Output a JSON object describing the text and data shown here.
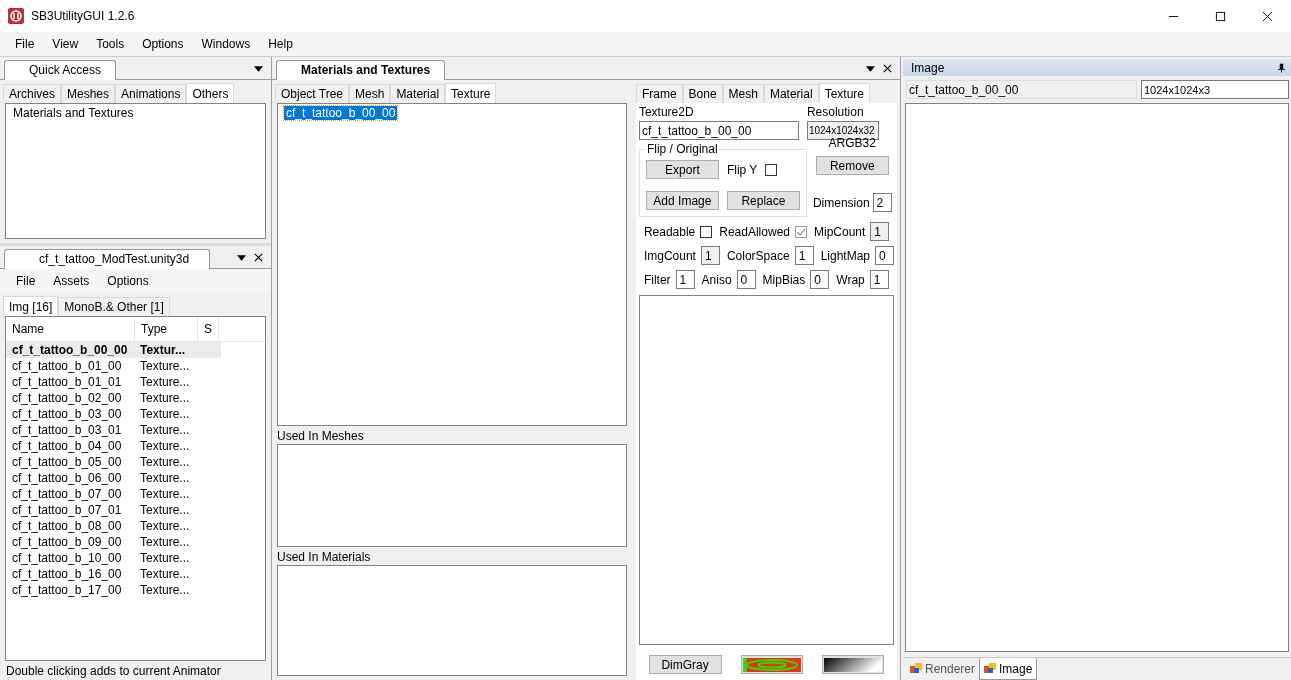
{
  "window": {
    "title": "SB3UtilityGUI 1.2.6"
  },
  "menu": [
    "File",
    "View",
    "Tools",
    "Options",
    "Windows",
    "Help"
  ],
  "quick_access": {
    "title": "Quick Access",
    "tabs": [
      {
        "label": "Archives",
        "selected": false
      },
      {
        "label": "Meshes",
        "selected": false
      },
      {
        "label": "Animations",
        "selected": false
      },
      {
        "label": "Others",
        "selected": true
      }
    ],
    "items": [
      "Materials and Textures"
    ]
  },
  "file_panel": {
    "title": "cf_t_tattoo_ModTest.unity3d",
    "menu": [
      "File",
      "Assets",
      "Options"
    ],
    "tabs": [
      {
        "label": "Img [16]",
        "selected": true
      },
      {
        "label": "MonoB.& Other [1]",
        "selected": false
      }
    ],
    "columns": [
      "Name",
      "Type",
      "S"
    ],
    "rows": [
      {
        "name": "cf_t_tattoo_b_00_00",
        "type": "Textur...",
        "selected": true
      },
      {
        "name": "cf_t_tattoo_b_01_00",
        "type": "Texture...",
        "selected": false
      },
      {
        "name": "cf_t_tattoo_b_01_01",
        "type": "Texture...",
        "selected": false
      },
      {
        "name": "cf_t_tattoo_b_02_00",
        "type": "Texture...",
        "selected": false
      },
      {
        "name": "cf_t_tattoo_b_03_00",
        "type": "Texture...",
        "selected": false
      },
      {
        "name": "cf_t_tattoo_b_03_01",
        "type": "Texture...",
        "selected": false
      },
      {
        "name": "cf_t_tattoo_b_04_00",
        "type": "Texture...",
        "selected": false
      },
      {
        "name": "cf_t_tattoo_b_05_00",
        "type": "Texture...",
        "selected": false
      },
      {
        "name": "cf_t_tattoo_b_06_00",
        "type": "Texture...",
        "selected": false
      },
      {
        "name": "cf_t_tattoo_b_07_00",
        "type": "Texture...",
        "selected": false
      },
      {
        "name": "cf_t_tattoo_b_07_01",
        "type": "Texture...",
        "selected": false
      },
      {
        "name": "cf_t_tattoo_b_08_00",
        "type": "Texture...",
        "selected": false
      },
      {
        "name": "cf_t_tattoo_b_09_00",
        "type": "Texture...",
        "selected": false
      },
      {
        "name": "cf_t_tattoo_b_10_00",
        "type": "Texture...",
        "selected": false
      },
      {
        "name": "cf_t_tattoo_b_16_00",
        "type": "Texture...",
        "selected": false
      },
      {
        "name": "cf_t_tattoo_b_17_00",
        "type": "Texture...",
        "selected": false
      }
    ],
    "status": "Double clicking adds to current Animator"
  },
  "editor": {
    "title": "Materials and Textures",
    "tabs": [
      {
        "label": "Object Tree",
        "selected": false
      },
      {
        "label": "Mesh",
        "selected": false
      },
      {
        "label": "Material",
        "selected": false
      },
      {
        "label": "Texture",
        "selected": true
      }
    ],
    "tree_items": [
      {
        "label": "cf_t_tattoo_b_00_00",
        "selected": true
      }
    ],
    "used_in_meshes": "Used In Meshes",
    "used_in_materials": "Used In Materials"
  },
  "texture": {
    "tabs": [
      {
        "label": "Frame",
        "selected": false
      },
      {
        "label": "Bone",
        "selected": false
      },
      {
        "label": "Mesh",
        "selected": false
      },
      {
        "label": "Material",
        "selected": false
      },
      {
        "label": "Texture",
        "selected": true
      }
    ],
    "name_label": "Texture2D",
    "name": "cf_t_tattoo_b_00_00",
    "resolution_label": "Resolution",
    "resolution": "1024x1024x32",
    "format": "ARGB32",
    "group": "Flip / Original",
    "export": "Export",
    "flip_y": {
      "label": "Flip Y",
      "checked": false
    },
    "add_image": "Add Image",
    "replace": "Replace",
    "remove": "Remove",
    "dimension": {
      "label": "Dimension",
      "value": "2"
    },
    "properties": [
      [
        {
          "label": "Readable",
          "kind": "check",
          "checked": false,
          "disabled": false
        },
        {
          "label": "ReadAllowed",
          "kind": "check",
          "checked": true,
          "disabled": true
        },
        {
          "label": "MipCount",
          "kind": "number",
          "value": "1",
          "disabled": true
        }
      ],
      [
        {
          "label": "ImgCount",
          "kind": "number",
          "value": "1",
          "disabled": true
        },
        {
          "label": "ColorSpace",
          "kind": "number",
          "value": "1",
          "disabled": false
        },
        {
          "label": "LightMap",
          "kind": "number",
          "value": "0",
          "disabled": false
        }
      ],
      [
        {
          "label": "Filter",
          "kind": "number",
          "value": "1",
          "disabled": false
        },
        {
          "label": "Aniso",
          "kind": "number",
          "value": "0",
          "disabled": false
        },
        {
          "label": "MipBias",
          "kind": "number",
          "value": "0",
          "disabled": false
        },
        {
          "label": "Wrap",
          "kind": "number",
          "value": "1",
          "disabled": false
        }
      ]
    ],
    "swatches": [
      {
        "kind": "text",
        "label": "DimGray"
      },
      {
        "kind": "spiral"
      },
      {
        "kind": "gradient"
      }
    ]
  },
  "image_panel": {
    "title": "Image",
    "name": "cf_t_tattoo_b_00_00",
    "resolution": "1024x1024x3",
    "tabs": [
      {
        "label": "Renderer",
        "selected": false
      },
      {
        "label": "Image",
        "selected": true
      }
    ]
  }
}
